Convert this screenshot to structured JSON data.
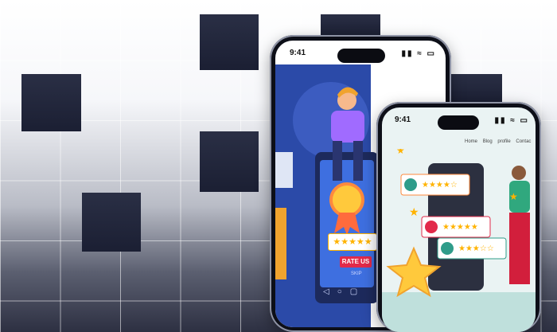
{
  "phone_back": {
    "time": "9:41",
    "rate_button": "RATE US",
    "skip_label": "SKIP",
    "status_icons": "▮▮ ≈ ▭"
  },
  "phone_front": {
    "time": "9:41",
    "nav_items": [
      "Home",
      "Blog",
      "profile",
      "Contac"
    ],
    "status_icons": "▮▮ ≈ ▭"
  },
  "colors": {
    "tile": "#1e2236",
    "illustration_blue": "#2b4aa8",
    "accent_red": "#e22a4a",
    "star": "#ffb300"
  },
  "icons": [
    "star-icon",
    "thumbs-up-icon",
    "user-avatar-icon",
    "back-nav-icon",
    "home-nav-icon",
    "recent-nav-icon"
  ]
}
